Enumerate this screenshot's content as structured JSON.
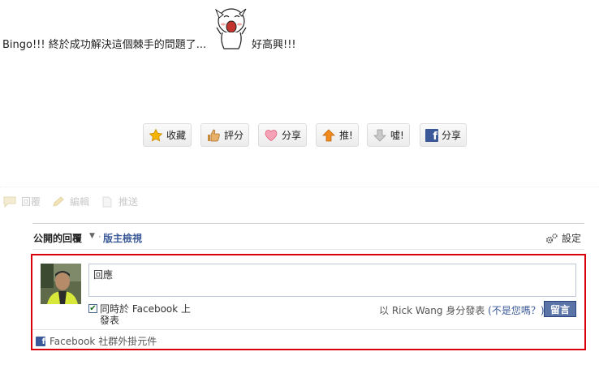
{
  "post": {
    "text_start": "Bingo!!! 終於成功解決這個棘手的問題了...",
    "text_end": "好高興!!!"
  },
  "actions": [
    {
      "label": "收藏",
      "icon": "star-icon"
    },
    {
      "label": "評分",
      "icon": "thumbs-up-icon"
    },
    {
      "label": "分享",
      "icon": "heart-icon"
    },
    {
      "label": "推!",
      "icon": "arrow-up-icon"
    },
    {
      "label": "噓!",
      "icon": "arrow-down-icon"
    },
    {
      "label": "分享",
      "icon": "facebook-icon"
    }
  ],
  "toolbar": {
    "reply": "回覆",
    "edit": "編輯",
    "trackback": "推送"
  },
  "plugin": {
    "tab_public": "公開的回覆",
    "tab_caret": "▼",
    "tab_sep": "·",
    "tab_admin": "版主檢視",
    "settings": "設定",
    "comment_value": "回應",
    "post_to_facebook": "同時於 Facebook 上發表",
    "identity_prefix": "以 Rick Wang 身分發表",
    "not_you": "(不是您嗎？)",
    "submit": "留言",
    "footer": "Facebook 社群外掛元件"
  },
  "colors": {
    "facebook_blue": "#3b5998",
    "highlight_red": "#d8000a",
    "submit_bg": "#5b74a8"
  }
}
